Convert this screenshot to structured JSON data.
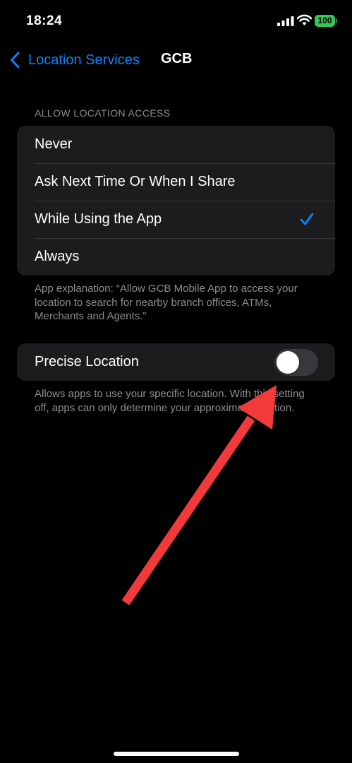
{
  "status_bar": {
    "time": "18:24",
    "battery_level": "100",
    "icons": [
      "signal-icon",
      "wifi-icon",
      "battery-icon"
    ],
    "battery_color": "#34c759"
  },
  "nav": {
    "back_label": "Location Services",
    "title": "GCB",
    "accent_color": "#0a84ff"
  },
  "access": {
    "header": "ALLOW LOCATION ACCESS",
    "options": [
      {
        "label": "Never",
        "selected": false
      },
      {
        "label": "Ask Next Time Or When I Share",
        "selected": false
      },
      {
        "label": "While Using the App",
        "selected": true
      },
      {
        "label": "Always",
        "selected": false
      }
    ],
    "explanation": "App explanation: “Allow GCB Mobile App to access your location to search for nearby branch offices, ATMs, Merchants and Agents.”"
  },
  "precise": {
    "label": "Precise Location",
    "enabled": false,
    "description": "Allows apps to use your specific location. With this setting off, apps can only determine your approximate location."
  },
  "annotation": {
    "arrow_color": "#f23a3a"
  }
}
